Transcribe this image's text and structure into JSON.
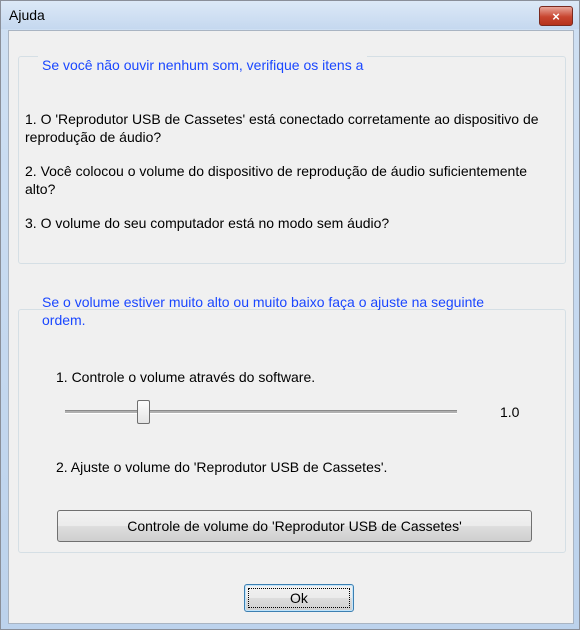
{
  "window": {
    "title": "Ajuda",
    "close_label": "×"
  },
  "group_check": {
    "title": "Se você não ouvir nenhum som, verifique os itens a",
    "items": [
      "1. O 'Reprodutor USB de Cassetes' está conectado corretamente ao dispositivo de reprodução de áudio?",
      "2. Você colocou o volume do dispositivo de reprodução de áudio suficientemente alto?",
      "3. O volume do seu computador está no modo sem áudio?"
    ]
  },
  "group_adjust": {
    "title": "Se o volume estiver muito alto ou muito baixo faça o ajuste na seguinte ordem.",
    "step1": "1. Controle o volume através do software.",
    "slider_value": "1.0",
    "slider_level_fraction": 0.19,
    "step2": "2. Ajuste o volume do 'Reprodutor USB de Cassetes'.",
    "volume_button_label": "Controle de volume do 'Reprodutor USB de Cassetes'"
  },
  "ok_label": "Ok"
}
